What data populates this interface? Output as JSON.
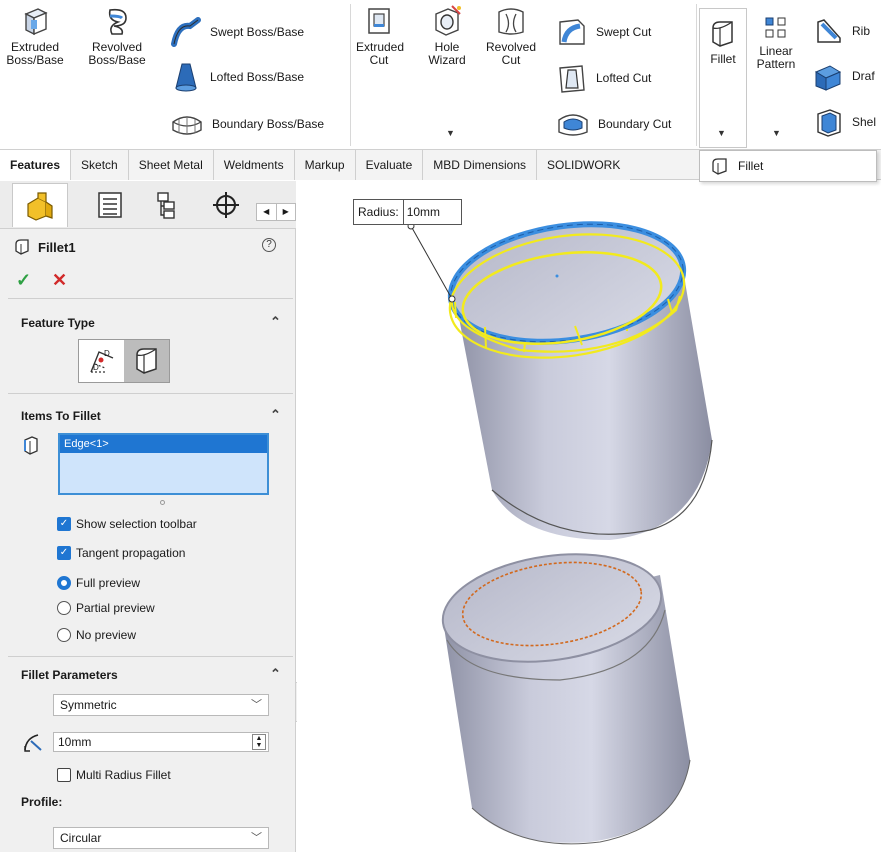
{
  "ribbon": {
    "extruded_boss": "Extruded Boss/Base",
    "revolved_boss": "Revolved Boss/Base",
    "swept_boss": "Swept Boss/Base",
    "lofted_boss": "Lofted Boss/Base",
    "boundary_boss": "Boundary Boss/Base",
    "extruded_cut": "Extruded Cut",
    "hole_wizard": "Hole Wizard",
    "revolved_cut": "Revolved Cut",
    "swept_cut": "Swept Cut",
    "lofted_cut": "Lofted Cut",
    "boundary_cut": "Boundary Cut",
    "fillet": "Fillet",
    "linear_pattern": "Linear Pattern",
    "rib": "Rib",
    "draft": "Draf",
    "shell": "Shel"
  },
  "tabs": [
    "Features",
    "Sketch",
    "Sheet Metal",
    "Weldments",
    "Markup",
    "Evaluate",
    "MBD Dimensions",
    "SOLIDWORK"
  ],
  "dropdown_menu": {
    "item": "Fillet"
  },
  "property_manager": {
    "title": "Fillet1",
    "help": "?",
    "feature_type": {
      "header": "Feature Type"
    },
    "items_to_fillet": {
      "header": "Items To Fillet",
      "selected": "Edge<1>"
    },
    "options": {
      "show_selection_toolbar": "Show selection toolbar",
      "tangent_propagation": "Tangent propagation",
      "full_preview": "Full preview",
      "partial_preview": "Partial preview",
      "no_preview": "No preview"
    },
    "fillet_parameters": {
      "header": "Fillet Parameters",
      "method": "Symmetric",
      "radius": "10mm",
      "multi_radius": "Multi Radius Fillet",
      "profile_label": "Profile:",
      "profile": "Circular"
    }
  },
  "graphics": {
    "radius_label": "Radius:",
    "radius_value": "10mm"
  },
  "colors": {
    "accent": "#1f76d2",
    "preview_yellow": "#f2ea1d",
    "selected_edge": "#3b8ee0",
    "result_edge": "#d2691e",
    "ok_green": "#2ea043",
    "cancel_red": "#d12a2a"
  }
}
